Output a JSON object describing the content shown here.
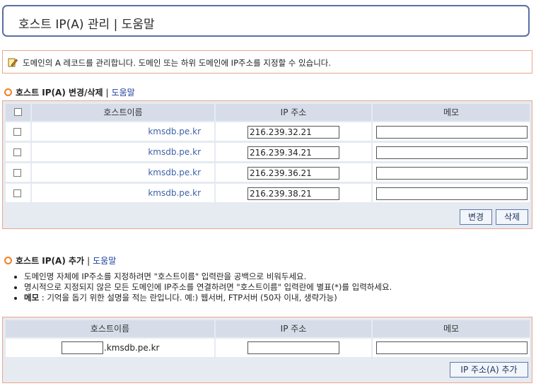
{
  "page_title": "호스트 IP(A) 관리 | 도움말",
  "info_text": "도메인의 A 레코드를 관리합니다. 도메인 또는 하위 도메인에 IP주소를 지정할 수 있습니다.",
  "edit_section": {
    "title": "호스트 IP(A) 변경/삭제",
    "help_label": "도움말",
    "columns": [
      "호스트이름",
      "IP 주소",
      "메모"
    ],
    "rows": [
      {
        "host": "kmsdb.pe.kr",
        "ip": "216.239.32.21",
        "memo": ""
      },
      {
        "host": "kmsdb.pe.kr",
        "ip": "216.239.34.21",
        "memo": ""
      },
      {
        "host": "kmsdb.pe.kr",
        "ip": "216.239.36.21",
        "memo": ""
      },
      {
        "host": "kmsdb.pe.kr",
        "ip": "216.239.38.21",
        "memo": ""
      }
    ],
    "change_button": "변경",
    "delete_button": "삭제"
  },
  "add_section": {
    "title": "호스트 IP(A) 추가",
    "help_label": "도움말",
    "notes": [
      {
        "bold": "",
        "text": "도메인명 자체에 IP주소를 지정하려면 \"호스트이름\" 입력란을 공백으로 비워두세요."
      },
      {
        "bold": "",
        "text": "명시적으로 지정되지 않은 모든 도메인에 IP주소를 연결하려면 \"호스트이름\" 입력란에 별표(*)를 입력하세요."
      },
      {
        "bold": "메모",
        "text": " : 기억을 돕기 위한 설명을 적는 란입니다. 예:) 웹서버, FTP서버 (50자 이내, 생략가능)"
      }
    ],
    "columns": [
      "호스트이름",
      "IP 주소",
      "메모"
    ],
    "domain_suffix": ".kmsdb.pe.kr",
    "host_value": "",
    "ip_value": "",
    "memo_value": "",
    "add_button": "IP 주소(A) 추가"
  },
  "colors": {
    "accent_orange": "#f08020",
    "link_blue": "#1a3c9c",
    "host_blue": "#3d62a8",
    "title_border": "#5a6fa3"
  }
}
